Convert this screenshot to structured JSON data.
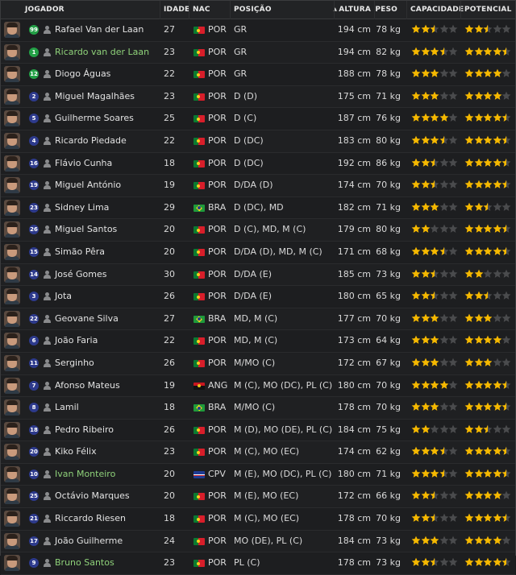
{
  "columns": {
    "jogador": "JOGADOR",
    "idade": "IDADE",
    "nac": "NAC",
    "posicao": "POSIÇÃO",
    "altura": "ALTURA",
    "peso": "PESO",
    "capacidade": "CAPACIDADE",
    "potencial": "POTENCIAL"
  },
  "colors": {
    "star_gold": "#f5b800",
    "star_empty": "#4a4b4d",
    "highlight_name": "#8fd27a"
  },
  "players": [
    {
      "num": "99",
      "gk": true,
      "name": "Rafael Van der Laan",
      "hl": false,
      "age": "27",
      "flag": "por",
      "nat": "POR",
      "pos": "GR",
      "height": "194 cm",
      "weight": "78 kg",
      "cap": 2.5,
      "pot": 2.5
    },
    {
      "num": "1",
      "gk": true,
      "name": "Ricardo van der Laan",
      "hl": true,
      "age": "23",
      "flag": "por",
      "nat": "POR",
      "pos": "GR",
      "height": "194 cm",
      "weight": "82 kg",
      "cap": 3.5,
      "pot": 4.5
    },
    {
      "num": "12",
      "gk": true,
      "name": "Diogo Águas",
      "hl": false,
      "age": "22",
      "flag": "por",
      "nat": "POR",
      "pos": "GR",
      "height": "188 cm",
      "weight": "78 kg",
      "cap": 3,
      "pot": 4
    },
    {
      "num": "2",
      "gk": false,
      "name": "Miguel Magalhães",
      "hl": false,
      "age": "23",
      "flag": "por",
      "nat": "POR",
      "pos": "D (D)",
      "height": "175 cm",
      "weight": "71 kg",
      "cap": 3,
      "pot": 4
    },
    {
      "num": "5",
      "gk": false,
      "name": "Guilherme Soares",
      "hl": false,
      "age": "25",
      "flag": "por",
      "nat": "POR",
      "pos": "D (C)",
      "height": "187 cm",
      "weight": "76 kg",
      "cap": 4,
      "pot": 4.5
    },
    {
      "num": "4",
      "gk": false,
      "name": "Ricardo Piedade",
      "hl": false,
      "age": "22",
      "flag": "por",
      "nat": "POR",
      "pos": "D (DC)",
      "height": "183 cm",
      "weight": "80 kg",
      "cap": 3.5,
      "pot": 4.5
    },
    {
      "num": "16",
      "gk": false,
      "name": "Flávio Cunha",
      "hl": false,
      "age": "18",
      "flag": "por",
      "nat": "POR",
      "pos": "D (DC)",
      "height": "192 cm",
      "weight": "86 kg",
      "cap": 2.5,
      "pot": 4.5
    },
    {
      "num": "19",
      "gk": false,
      "name": "Miguel António",
      "hl": false,
      "age": "19",
      "flag": "por",
      "nat": "POR",
      "pos": "D/DA (D)",
      "height": "174 cm",
      "weight": "70 kg",
      "cap": 2.5,
      "pot": 4.5
    },
    {
      "num": "23",
      "gk": false,
      "name": "Sidney Lima",
      "hl": false,
      "age": "29",
      "flag": "bra",
      "nat": "BRA",
      "pos": "D (DC), MD",
      "height": "182 cm",
      "weight": "71 kg",
      "cap": 3,
      "pot": 2.5
    },
    {
      "num": "26",
      "gk": false,
      "name": "Miguel Santos",
      "hl": false,
      "age": "20",
      "flag": "por",
      "nat": "POR",
      "pos": "D (C), MD, M (C)",
      "height": "179 cm",
      "weight": "80 kg",
      "cap": 2,
      "pot": 4.5
    },
    {
      "num": "15",
      "gk": false,
      "name": "Simão Pêra",
      "hl": false,
      "age": "20",
      "flag": "por",
      "nat": "POR",
      "pos": "D/DA (D), MD, M (C)",
      "height": "171 cm",
      "weight": "68 kg",
      "cap": 3.5,
      "pot": 4.5
    },
    {
      "num": "14",
      "gk": false,
      "name": "José Gomes",
      "hl": false,
      "age": "30",
      "flag": "por",
      "nat": "POR",
      "pos": "D/DA (E)",
      "height": "185 cm",
      "weight": "73 kg",
      "cap": 2.5,
      "pot": 2
    },
    {
      "num": "3",
      "gk": false,
      "name": "Jota",
      "hl": false,
      "age": "26",
      "flag": "por",
      "nat": "POR",
      "pos": "D/DA (E)",
      "height": "180 cm",
      "weight": "65 kg",
      "cap": 2.5,
      "pot": 2.5
    },
    {
      "num": "22",
      "gk": false,
      "name": "Geovane Silva",
      "hl": false,
      "age": "27",
      "flag": "bra",
      "nat": "BRA",
      "pos": "MD, M (C)",
      "height": "177 cm",
      "weight": "70 kg",
      "cap": 3,
      "pot": 3
    },
    {
      "num": "6",
      "gk": false,
      "name": "João Faria",
      "hl": false,
      "age": "22",
      "flag": "por",
      "nat": "POR",
      "pos": "MD, M (C)",
      "height": "173 cm",
      "weight": "64 kg",
      "cap": 3,
      "pot": 4
    },
    {
      "num": "11",
      "gk": false,
      "name": "Serginho",
      "hl": false,
      "age": "26",
      "flag": "por",
      "nat": "POR",
      "pos": "M/MO (C)",
      "height": "172 cm",
      "weight": "67 kg",
      "cap": 3,
      "pot": 3
    },
    {
      "num": "7",
      "gk": false,
      "name": "Afonso Mateus",
      "hl": false,
      "age": "19",
      "flag": "ang",
      "nat": "ANG",
      "pos": "M (C), MO (DC), PL (C)",
      "height": "180 cm",
      "weight": "70 kg",
      "cap": 4,
      "pot": 4.5
    },
    {
      "num": "8",
      "gk": false,
      "name": "Lamil",
      "hl": false,
      "age": "18",
      "flag": "bra",
      "nat": "BRA",
      "pos": "M/MO (C)",
      "height": "178 cm",
      "weight": "70 kg",
      "cap": 3,
      "pot": 4.5
    },
    {
      "num": "18",
      "gk": false,
      "name": "Pedro Ribeiro",
      "hl": false,
      "age": "26",
      "flag": "por",
      "nat": "POR",
      "pos": "M (D), MO (DE), PL (C)",
      "height": "184 cm",
      "weight": "75 kg",
      "cap": 2,
      "pot": 2.5
    },
    {
      "num": "20",
      "gk": false,
      "name": "Kiko Félix",
      "hl": false,
      "age": "23",
      "flag": "por",
      "nat": "POR",
      "pos": "M (C), MO (EC)",
      "height": "174 cm",
      "weight": "62 kg",
      "cap": 3.5,
      "pot": 4.5
    },
    {
      "num": "10",
      "gk": false,
      "name": "Ivan Monteiro",
      "hl": true,
      "age": "20",
      "flag": "cpv",
      "nat": "CPV",
      "pos": "M (E), MO (DC), PL (C)",
      "height": "180 cm",
      "weight": "71 kg",
      "cap": 3.5,
      "pot": 4.5
    },
    {
      "num": "25",
      "gk": false,
      "name": "Octávio Marques",
      "hl": false,
      "age": "20",
      "flag": "por",
      "nat": "POR",
      "pos": "M (E), MO (EC)",
      "height": "172 cm",
      "weight": "66 kg",
      "cap": 2.5,
      "pot": 4
    },
    {
      "num": "21",
      "gk": false,
      "name": "Riccardo Riesen",
      "hl": false,
      "age": "18",
      "flag": "por",
      "nat": "POR",
      "pos": "M (C), MO (EC)",
      "height": "178 cm",
      "weight": "70 kg",
      "cap": 2.5,
      "pot": 4.5
    },
    {
      "num": "17",
      "gk": false,
      "name": "João Guilherme",
      "hl": false,
      "age": "24",
      "flag": "por",
      "nat": "POR",
      "pos": "MO (DE), PL (C)",
      "height": "184 cm",
      "weight": "73 kg",
      "cap": 3,
      "pot": 4
    },
    {
      "num": "9",
      "gk": false,
      "name": "Bruno Santos",
      "hl": true,
      "age": "23",
      "flag": "por",
      "nat": "POR",
      "pos": "PL (C)",
      "height": "178 cm",
      "weight": "73 kg",
      "cap": 2.5,
      "pot": 4.5
    }
  ]
}
